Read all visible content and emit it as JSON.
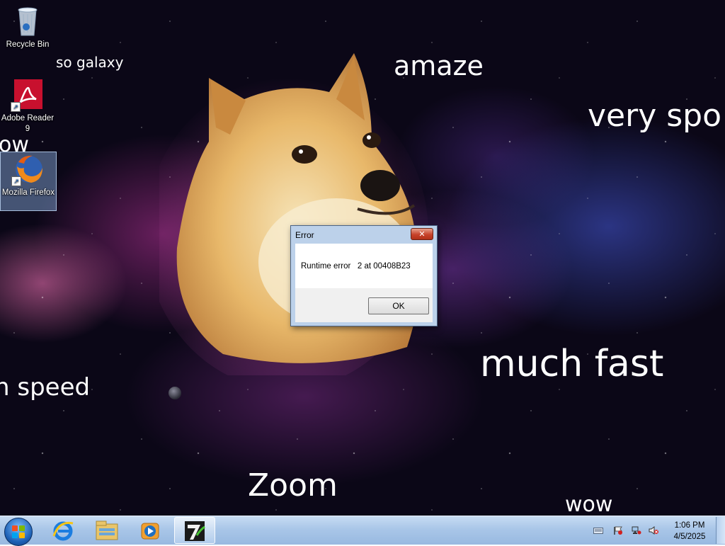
{
  "desktop": {
    "icons": [
      {
        "label": "Recycle Bin",
        "icon": "recycle-bin-icon"
      },
      {
        "label": "Adobe Reader 9",
        "icon": "adobe-reader-icon"
      },
      {
        "label": "Mozilla Firefox",
        "icon": "firefox-icon"
      }
    ],
    "wallpaper_text": {
      "so_galaxy": "so galaxy",
      "amaze": "amaze",
      "very_spo": "very spo",
      "ow": "ow",
      "n_speed": "n speed",
      "much_fast": "much fast",
      "zoom": "Zoom",
      "wow": "wow"
    }
  },
  "dialog": {
    "title": "Error",
    "close_glyph": "✕",
    "message": "Runtime error   2 at 00408B23",
    "ok_label": "OK"
  },
  "taskbar": {
    "pinned": [
      {
        "name": "internet-explorer-icon"
      },
      {
        "name": "windows-explorer-icon"
      },
      {
        "name": "windows-media-player-icon"
      },
      {
        "name": "7-zip-app-icon",
        "active": true
      }
    ],
    "tray": [
      "keyboard-icon",
      "action-center-flag-icon",
      "network-icon",
      "volume-muted-icon"
    ],
    "time": "1:06 PM",
    "date": "4/5/2025"
  },
  "colors": {
    "taskbar_top": "#c7dcf3",
    "dialog_frame": "#bcd1ea",
    "close_button": "#c7422a"
  }
}
